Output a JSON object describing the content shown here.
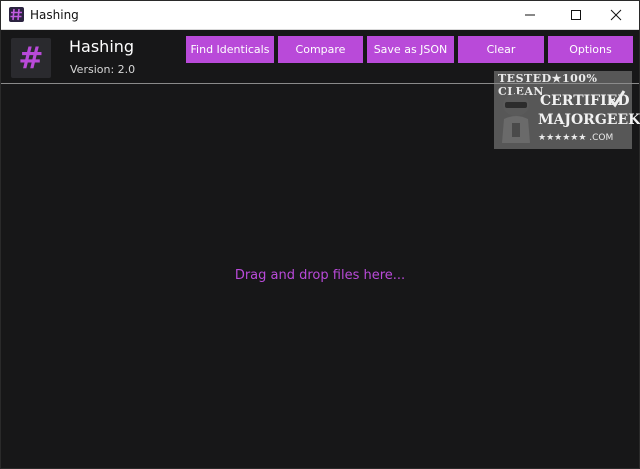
{
  "window": {
    "title": "Hashing",
    "controls": {
      "minimize": "minimize-icon",
      "maximize": "maximize-icon",
      "close": "close-icon"
    }
  },
  "header": {
    "app_name": "Hashing",
    "version": "Version: 2.0",
    "logo_glyph": "#"
  },
  "toolbar": {
    "find_identicals": "Find Identicals",
    "compare": "Compare",
    "save_as_json": "Save as JSON",
    "clear": "Clear",
    "options": "Options"
  },
  "main": {
    "drop_hint": "Drag and drop files here..."
  },
  "watermark": {
    "line1": "TESTED★100% CLEAN",
    "line2": "CERTIFIED",
    "line3": "MAJORGEEKS",
    "line4": "★★★★★★ .COM"
  },
  "colors": {
    "accent": "#b94ad9",
    "background": "#171718",
    "titlebar": "#ffffff"
  }
}
